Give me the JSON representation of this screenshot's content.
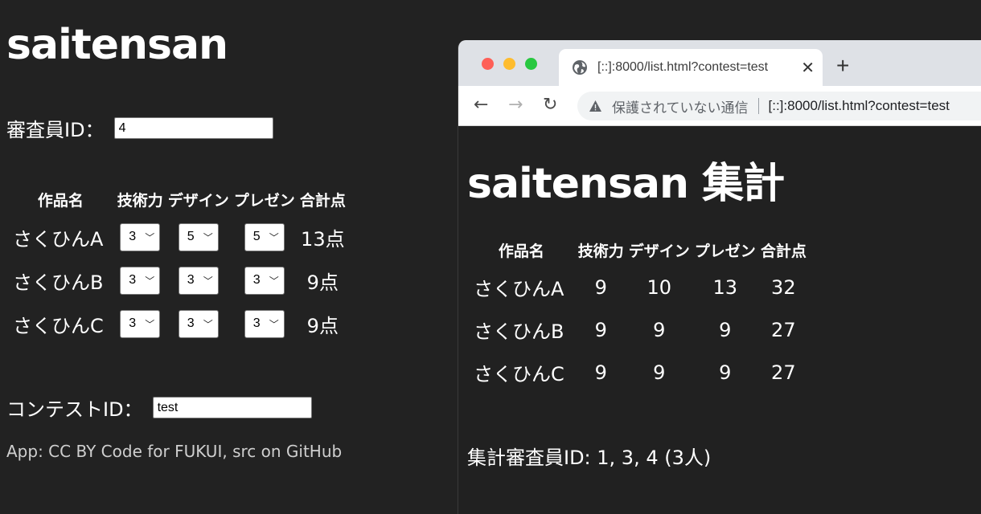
{
  "form": {
    "title": "saitensan",
    "judge_label": "審査員ID：",
    "judge_value": "4",
    "headers": [
      "作品名",
      "技術力",
      "デザイン",
      "プレゼン",
      "合計点"
    ],
    "rows": [
      {
        "name": "さくひんA",
        "tech": "3",
        "design": "5",
        "present": "5",
        "total": "13点"
      },
      {
        "name": "さくひんB",
        "tech": "3",
        "design": "3",
        "present": "3",
        "total": "9点"
      },
      {
        "name": "さくひんC",
        "tech": "3",
        "design": "3",
        "present": "3",
        "total": "9点"
      }
    ],
    "contest_label": "コンテストID：",
    "contest_value": "test",
    "credit_prefix": "App: ",
    "credit_license": "CC BY",
    "credit_author": "Code for FUKUI",
    "credit_mid": ", src on ",
    "credit_repo": "GitHub"
  },
  "browser": {
    "tab_title": "[::]:8000/list.html?contest=test",
    "security_text": "保護されていない通信",
    "url": "[::]:8000/list.html?contest=test"
  },
  "summary_page": {
    "title": "saitensan 集計",
    "headers": [
      "作品名",
      "技術力",
      "デザイン",
      "プレゼン",
      "合計点"
    ],
    "rows": [
      {
        "name": "さくひんA",
        "tech": "9",
        "design": "10",
        "present": "13",
        "total": "32"
      },
      {
        "name": "さくひんB",
        "tech": "9",
        "design": "9",
        "present": "9",
        "total": "27"
      },
      {
        "name": "さくひんC",
        "tech": "9",
        "design": "9",
        "present": "9",
        "total": "27"
      }
    ],
    "judges_text": "集計審査員ID: 1, 3, 4 (3人)"
  }
}
